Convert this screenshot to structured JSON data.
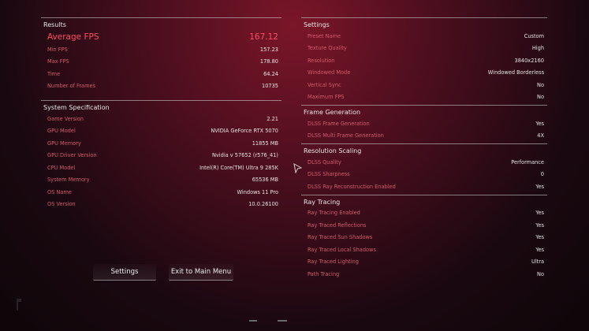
{
  "results": {
    "title": "Results",
    "highlight": {
      "label": "Average FPS",
      "value": "167.12"
    },
    "rows": [
      {
        "label": "Min FPS",
        "value": "157.23"
      },
      {
        "label": "Max FPS",
        "value": "178.80"
      },
      {
        "label": "Time",
        "value": "64.24"
      },
      {
        "label": "Number of Frames",
        "value": "10735"
      }
    ]
  },
  "system": {
    "title": "System Specification",
    "rows": [
      {
        "label": "Game Version",
        "value": "2.21"
      },
      {
        "label": "GPU Model",
        "value": "NVIDIA GeForce RTX 5070"
      },
      {
        "label": "GPU Memory",
        "value": "11855 MB"
      },
      {
        "label": "GPU Driver Version",
        "value": "Nvidia v 57652 (r576_41)"
      },
      {
        "label": "CPU Model",
        "value": "Intel(R) Core(TM) Ultra 9 285K"
      },
      {
        "label": "System Memory",
        "value": "65536 MB"
      },
      {
        "label": "OS Name",
        "value": "Windows 11 Pro"
      },
      {
        "label": "OS Version",
        "value": "10.0.26100"
      }
    ]
  },
  "settings": {
    "title": "Settings",
    "rows": [
      {
        "label": "Preset Name",
        "value": "Custom"
      },
      {
        "label": "Texture Quality",
        "value": "High"
      },
      {
        "label": "Resolution",
        "value": "3840x2160"
      },
      {
        "label": "Windowed Mode",
        "value": "Windowed Borderless"
      },
      {
        "label": "Vertical Sync",
        "value": "No"
      },
      {
        "label": "Maximum FPS",
        "value": "No"
      }
    ]
  },
  "frame_gen": {
    "title": "Frame Generation",
    "rows": [
      {
        "label": "DLSS Frame Generation",
        "value": "Yes"
      },
      {
        "label": "DLSS Multi Frame Generation",
        "value": "4X"
      }
    ]
  },
  "res_scaling": {
    "title": "Resolution Scaling",
    "rows": [
      {
        "label": "DLSS Quality",
        "value": "Performance"
      },
      {
        "label": "DLSS Sharpness",
        "value": "0"
      },
      {
        "label": "DLSS Ray Reconstruction Enabled",
        "value": "Yes"
      }
    ]
  },
  "ray_tracing": {
    "title": "Ray Tracing",
    "rows": [
      {
        "label": "Ray Tracing Enabled",
        "value": "Yes"
      },
      {
        "label": "Ray Traced Reflections",
        "value": "Yes"
      },
      {
        "label": "Ray Traced Sun Shadows",
        "value": "Yes"
      },
      {
        "label": "Ray Traced Local Shadows",
        "value": "Yes"
      },
      {
        "label": "Ray Traced Lighting",
        "value": "Ultra"
      },
      {
        "label": "Path Tracing",
        "value": "No"
      }
    ]
  },
  "buttons": {
    "settings": "Settings",
    "exit": "Exit to Main Menu"
  },
  "colors": {
    "label": "#d25a6c",
    "highlight": "#ff4d63",
    "value": "#e3e3e3"
  }
}
